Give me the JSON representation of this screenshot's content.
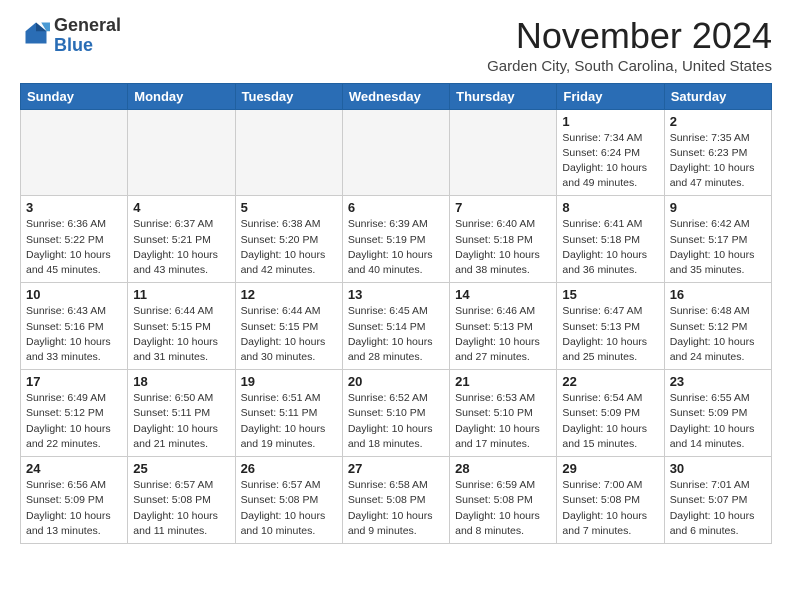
{
  "logo": {
    "general": "General",
    "blue": "Blue"
  },
  "header": {
    "month": "November 2024",
    "location": "Garden City, South Carolina, United States"
  },
  "days_of_week": [
    "Sunday",
    "Monday",
    "Tuesday",
    "Wednesday",
    "Thursday",
    "Friday",
    "Saturday"
  ],
  "weeks": [
    [
      {
        "day": "",
        "info": ""
      },
      {
        "day": "",
        "info": ""
      },
      {
        "day": "",
        "info": ""
      },
      {
        "day": "",
        "info": ""
      },
      {
        "day": "",
        "info": ""
      },
      {
        "day": "1",
        "info": "Sunrise: 7:34 AM\nSunset: 6:24 PM\nDaylight: 10 hours\nand 49 minutes."
      },
      {
        "day": "2",
        "info": "Sunrise: 7:35 AM\nSunset: 6:23 PM\nDaylight: 10 hours\nand 47 minutes."
      }
    ],
    [
      {
        "day": "3",
        "info": "Sunrise: 6:36 AM\nSunset: 5:22 PM\nDaylight: 10 hours\nand 45 minutes."
      },
      {
        "day": "4",
        "info": "Sunrise: 6:37 AM\nSunset: 5:21 PM\nDaylight: 10 hours\nand 43 minutes."
      },
      {
        "day": "5",
        "info": "Sunrise: 6:38 AM\nSunset: 5:20 PM\nDaylight: 10 hours\nand 42 minutes."
      },
      {
        "day": "6",
        "info": "Sunrise: 6:39 AM\nSunset: 5:19 PM\nDaylight: 10 hours\nand 40 minutes."
      },
      {
        "day": "7",
        "info": "Sunrise: 6:40 AM\nSunset: 5:18 PM\nDaylight: 10 hours\nand 38 minutes."
      },
      {
        "day": "8",
        "info": "Sunrise: 6:41 AM\nSunset: 5:18 PM\nDaylight: 10 hours\nand 36 minutes."
      },
      {
        "day": "9",
        "info": "Sunrise: 6:42 AM\nSunset: 5:17 PM\nDaylight: 10 hours\nand 35 minutes."
      }
    ],
    [
      {
        "day": "10",
        "info": "Sunrise: 6:43 AM\nSunset: 5:16 PM\nDaylight: 10 hours\nand 33 minutes."
      },
      {
        "day": "11",
        "info": "Sunrise: 6:44 AM\nSunset: 5:15 PM\nDaylight: 10 hours\nand 31 minutes."
      },
      {
        "day": "12",
        "info": "Sunrise: 6:44 AM\nSunset: 5:15 PM\nDaylight: 10 hours\nand 30 minutes."
      },
      {
        "day": "13",
        "info": "Sunrise: 6:45 AM\nSunset: 5:14 PM\nDaylight: 10 hours\nand 28 minutes."
      },
      {
        "day": "14",
        "info": "Sunrise: 6:46 AM\nSunset: 5:13 PM\nDaylight: 10 hours\nand 27 minutes."
      },
      {
        "day": "15",
        "info": "Sunrise: 6:47 AM\nSunset: 5:13 PM\nDaylight: 10 hours\nand 25 minutes."
      },
      {
        "day": "16",
        "info": "Sunrise: 6:48 AM\nSunset: 5:12 PM\nDaylight: 10 hours\nand 24 minutes."
      }
    ],
    [
      {
        "day": "17",
        "info": "Sunrise: 6:49 AM\nSunset: 5:12 PM\nDaylight: 10 hours\nand 22 minutes."
      },
      {
        "day": "18",
        "info": "Sunrise: 6:50 AM\nSunset: 5:11 PM\nDaylight: 10 hours\nand 21 minutes."
      },
      {
        "day": "19",
        "info": "Sunrise: 6:51 AM\nSunset: 5:11 PM\nDaylight: 10 hours\nand 19 minutes."
      },
      {
        "day": "20",
        "info": "Sunrise: 6:52 AM\nSunset: 5:10 PM\nDaylight: 10 hours\nand 18 minutes."
      },
      {
        "day": "21",
        "info": "Sunrise: 6:53 AM\nSunset: 5:10 PM\nDaylight: 10 hours\nand 17 minutes."
      },
      {
        "day": "22",
        "info": "Sunrise: 6:54 AM\nSunset: 5:09 PM\nDaylight: 10 hours\nand 15 minutes."
      },
      {
        "day": "23",
        "info": "Sunrise: 6:55 AM\nSunset: 5:09 PM\nDaylight: 10 hours\nand 14 minutes."
      }
    ],
    [
      {
        "day": "24",
        "info": "Sunrise: 6:56 AM\nSunset: 5:09 PM\nDaylight: 10 hours\nand 13 minutes."
      },
      {
        "day": "25",
        "info": "Sunrise: 6:57 AM\nSunset: 5:08 PM\nDaylight: 10 hours\nand 11 minutes."
      },
      {
        "day": "26",
        "info": "Sunrise: 6:57 AM\nSunset: 5:08 PM\nDaylight: 10 hours\nand 10 minutes."
      },
      {
        "day": "27",
        "info": "Sunrise: 6:58 AM\nSunset: 5:08 PM\nDaylight: 10 hours\nand 9 minutes."
      },
      {
        "day": "28",
        "info": "Sunrise: 6:59 AM\nSunset: 5:08 PM\nDaylight: 10 hours\nand 8 minutes."
      },
      {
        "day": "29",
        "info": "Sunrise: 7:00 AM\nSunset: 5:08 PM\nDaylight: 10 hours\nand 7 minutes."
      },
      {
        "day": "30",
        "info": "Sunrise: 7:01 AM\nSunset: 5:07 PM\nDaylight: 10 hours\nand 6 minutes."
      }
    ]
  ]
}
